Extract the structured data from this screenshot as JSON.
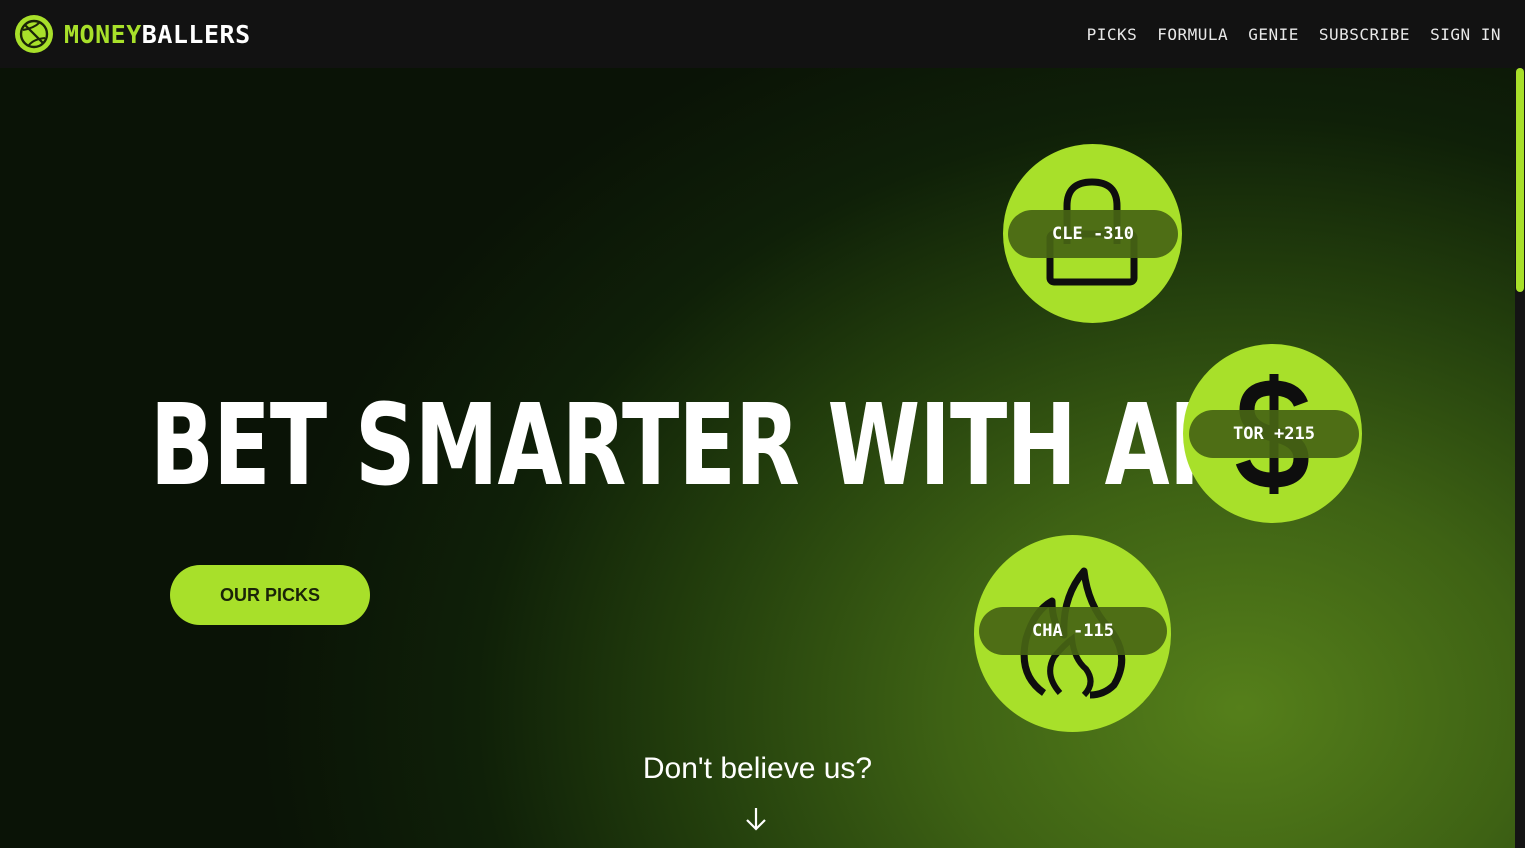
{
  "brand": {
    "prefix": "MONEY",
    "suffix": "BALLERS",
    "logo_icon": "basketball-icon"
  },
  "nav": {
    "items": [
      {
        "label": "PICKS"
      },
      {
        "label": "FORMULA"
      },
      {
        "label": "GENIE"
      },
      {
        "label": "SUBSCRIBE"
      },
      {
        "label": "SIGN IN"
      }
    ]
  },
  "hero": {
    "title": "BET SMARTER WITH AI",
    "cta_label": "OUR PICKS",
    "picks": [
      {
        "label": "CLE -310",
        "icon": "lock-icon"
      },
      {
        "label": "TOR +215",
        "icon": "dollar-icon"
      },
      {
        "label": "CHA -115",
        "icon": "flame-icon"
      }
    ],
    "disbelief_text": "Don't believe us?",
    "arrow_icon": "arrow-down-icon"
  },
  "colors": {
    "accent": "#a8e02a",
    "navbar_bg": "#121212",
    "hero_dark": "#0a1306",
    "hero_light": "#557f1a",
    "pill_bg": "#466414"
  }
}
